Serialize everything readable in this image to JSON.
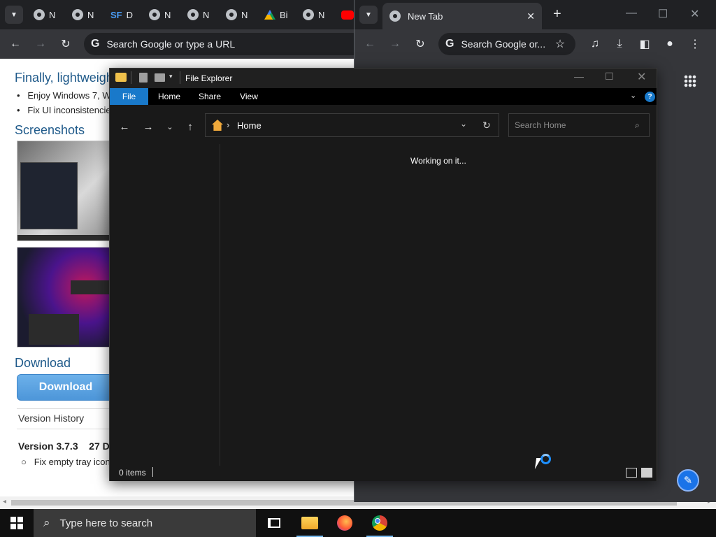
{
  "chrome_left": {
    "tabs": [
      {
        "label": "N",
        "icon": "chrome-icon"
      },
      {
        "label": "N",
        "icon": "chrome-icon"
      },
      {
        "label": "D",
        "icon": "sf-icon",
        "icon_text": "SF"
      },
      {
        "label": "N",
        "icon": "chrome-icon"
      },
      {
        "label": "N",
        "icon": "chrome-icon"
      },
      {
        "label": "N",
        "icon": "chrome-icon"
      },
      {
        "label": "Bi",
        "icon": "drive-icon"
      },
      {
        "label": "N",
        "icon": "chrome-icon"
      }
    ],
    "omnibox_placeholder": "Search Google or type a URL",
    "page": {
      "heading_partial": "Finally, lightweigh",
      "bullets": [
        "Enjoy Windows 7, W",
        "Fix UI inconsistencie"
      ],
      "screenshots_heading": "Screenshots",
      "download_heading": "Download",
      "download_button": "Download",
      "version_history": "Version History",
      "version_label": "Version 3.7.3",
      "version_date_partial": "27 D",
      "version_item_partial": "Fix empty tray icon"
    }
  },
  "chrome_right": {
    "tab_title": "New Tab",
    "omnibox_placeholder": "Search Google or..."
  },
  "explorer": {
    "title": "File Explorer",
    "ribbon_tabs": [
      "File",
      "Home",
      "Share",
      "View"
    ],
    "address": "Home",
    "search_placeholder": "Search Home",
    "status_message": "Working on it...",
    "item_count": "0 items"
  },
  "taskbar": {
    "search_placeholder": "Type here to search"
  },
  "colors": {
    "ribbon_file_tab": "#1979ca",
    "download_button": "#5aa3e3",
    "heading_blue": "#1f5a8a",
    "fab_blue": "#1a73e8"
  }
}
